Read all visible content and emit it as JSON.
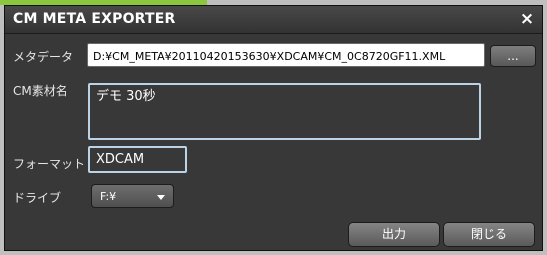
{
  "window": {
    "title": "CM META EXPORTER",
    "close_glyph": "×"
  },
  "form": {
    "metadata_label": "メタデータ",
    "metadata_path": "D:¥CM_META¥20110420153630¥XDCAM¥CM_0C8720GF11.XML",
    "browse_label": "...",
    "material_name_label": "CM素材名",
    "material_name_value": "デモ 30秒",
    "format_label": "フォーマット",
    "format_value": "XDCAM",
    "drive_label": "ドライブ",
    "drive_value": "F:¥"
  },
  "buttons": {
    "output_label": "出力",
    "close_label": "閉じる"
  },
  "colors": {
    "accent": "#8cc63e",
    "window_bg": "#383838",
    "field_border": "#bcd3e6"
  },
  "icons": {
    "close": "close-icon",
    "drive_caret": "chevron-down-icon"
  }
}
